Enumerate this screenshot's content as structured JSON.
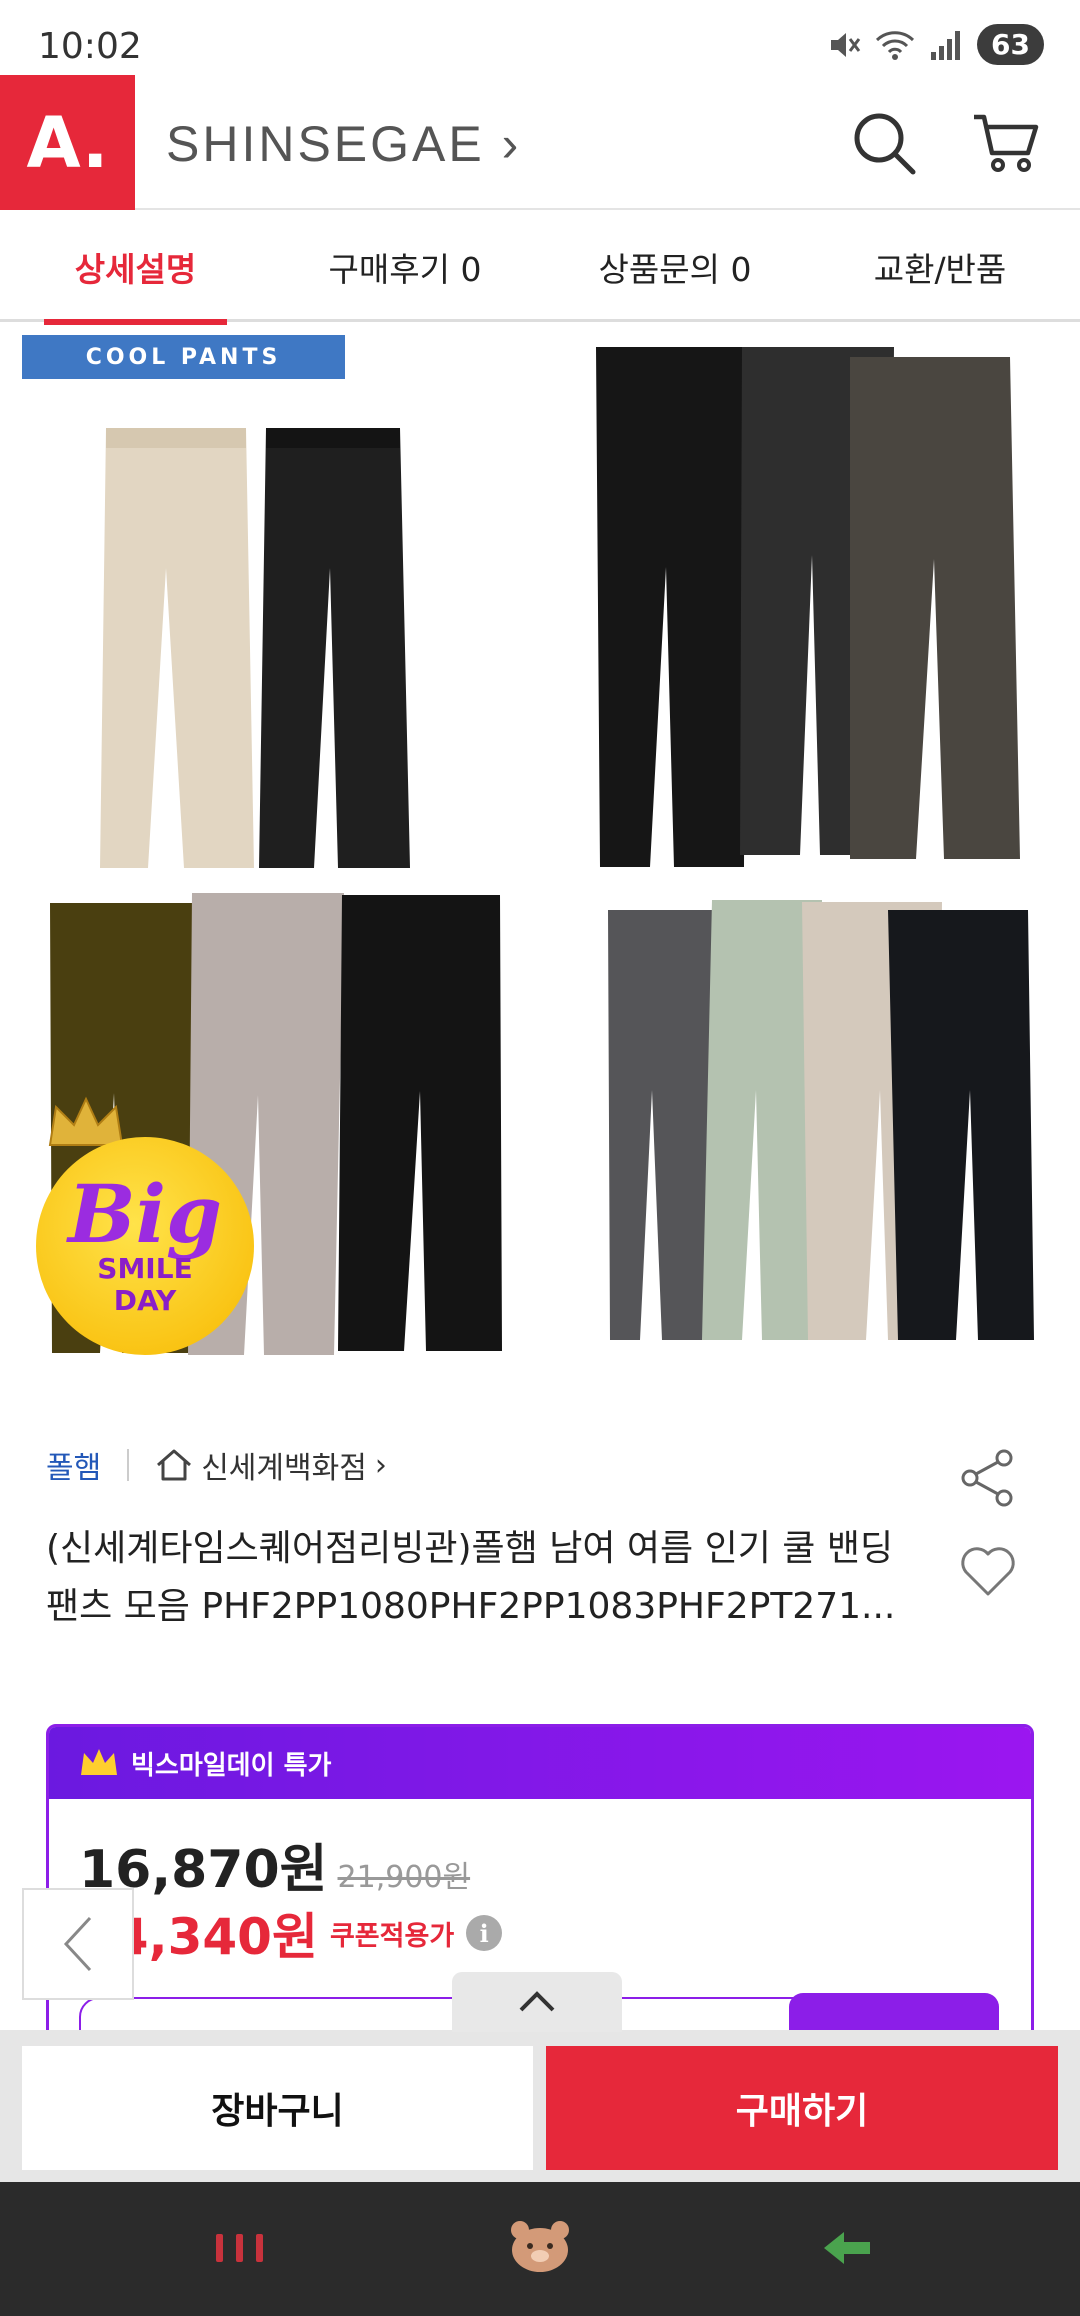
{
  "status": {
    "time": "10:02",
    "battery": "63"
  },
  "header": {
    "logo": "A.",
    "brand": "SHINSEGAE",
    "brand_chevron": "›"
  },
  "tabs": [
    {
      "label": "상세설명"
    },
    {
      "label": "구매후기 0"
    },
    {
      "label": "상품문의 0"
    },
    {
      "label": "교환/반품"
    }
  ],
  "gallery": {
    "banner": "COOL PANTS",
    "badge_big": "Big",
    "badge_line1": "SMILE",
    "badge_line2": "DAY"
  },
  "product": {
    "brand": "폴햄",
    "store": "신세계백화점",
    "store_chevron": "›",
    "title": "(신세계타임스퀘어점리빙관)폴햄 남여 여름 인기 쿨 밴딩 팬츠 모음  PHF2PP1080PHF2PP1083PHF2PT271..."
  },
  "deal": {
    "label": "빅스마일데이 특가",
    "price": "16,870원",
    "original_price": "21,900원",
    "coupon_price": "14,340원",
    "coupon_label": "쿠폰적용가",
    "info": "i"
  },
  "actions": {
    "cart": "장바구니",
    "buy": "구매하기"
  },
  "colors": {
    "accent": "#e6283a",
    "deal_purple": "#8c1ee8",
    "link_blue": "#2358b8"
  }
}
